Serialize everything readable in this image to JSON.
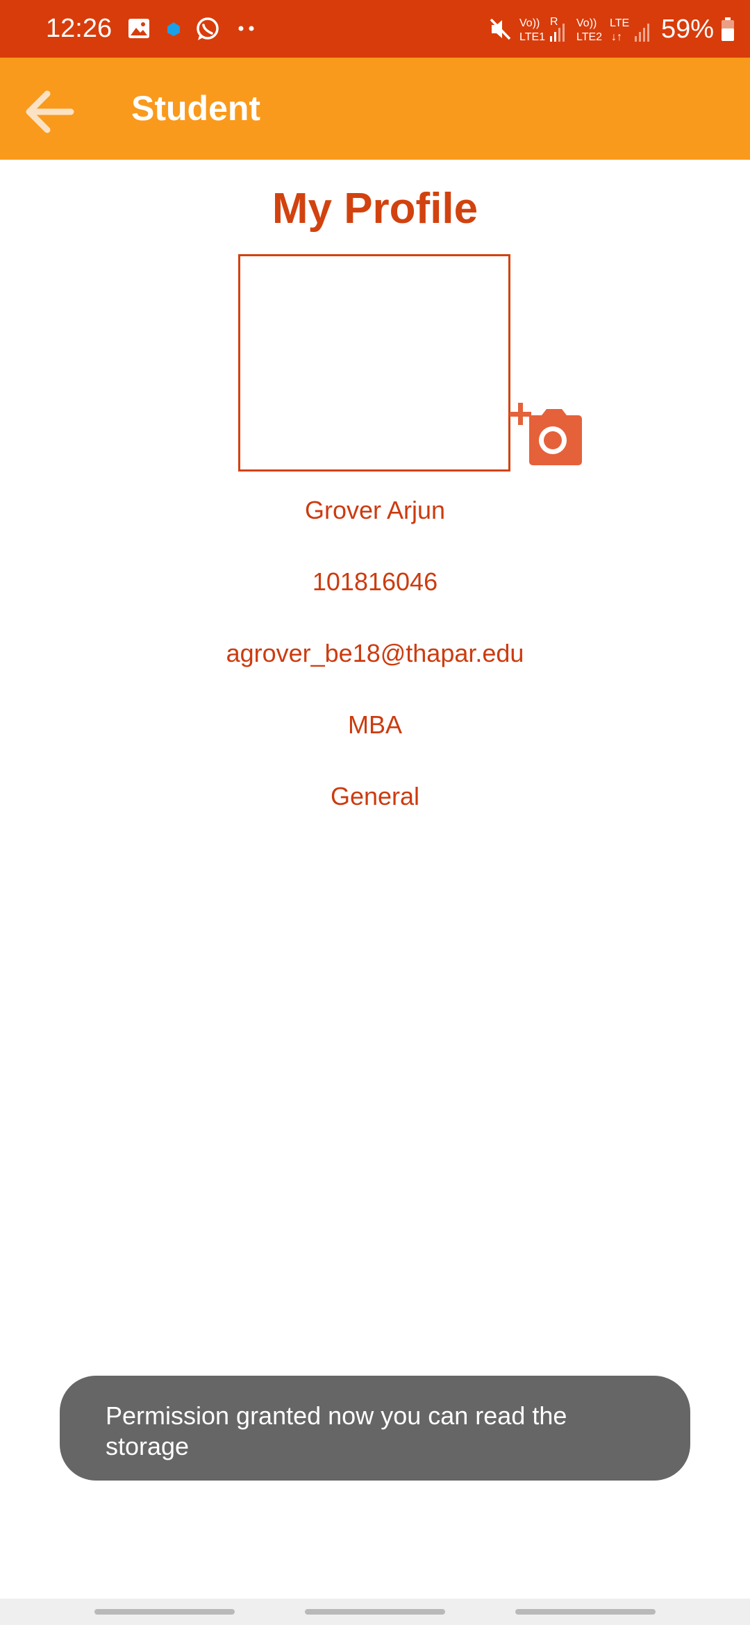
{
  "status_bar": {
    "time": "12:26",
    "battery": "59%",
    "sim1_label": "Vo)) LTE1",
    "sim2_label": "Vo)) LTE2",
    "roaming": "R",
    "network": "LTE",
    "bg_color": "#d83c0b",
    "icons": [
      "gallery-icon",
      "notification-dot-icon",
      "whatsapp-icon",
      "more-dots-icon",
      "mute-icon",
      "signal-icon",
      "battery-icon"
    ]
  },
  "app_bar": {
    "title": "Student",
    "back_icon": "arrow-back-icon",
    "bg_color": "#f99a1c"
  },
  "profile": {
    "heading": "My Profile",
    "name": "Grover Arjun",
    "roll_number": "101816046",
    "email": "agrover_be18@thapar.edu",
    "program": "MBA",
    "category": "General",
    "add_photo_icon": "add-a-photo-icon",
    "accent_color": "#d2420f"
  },
  "toast": {
    "message": "Permission granted now you can read the storage"
  }
}
